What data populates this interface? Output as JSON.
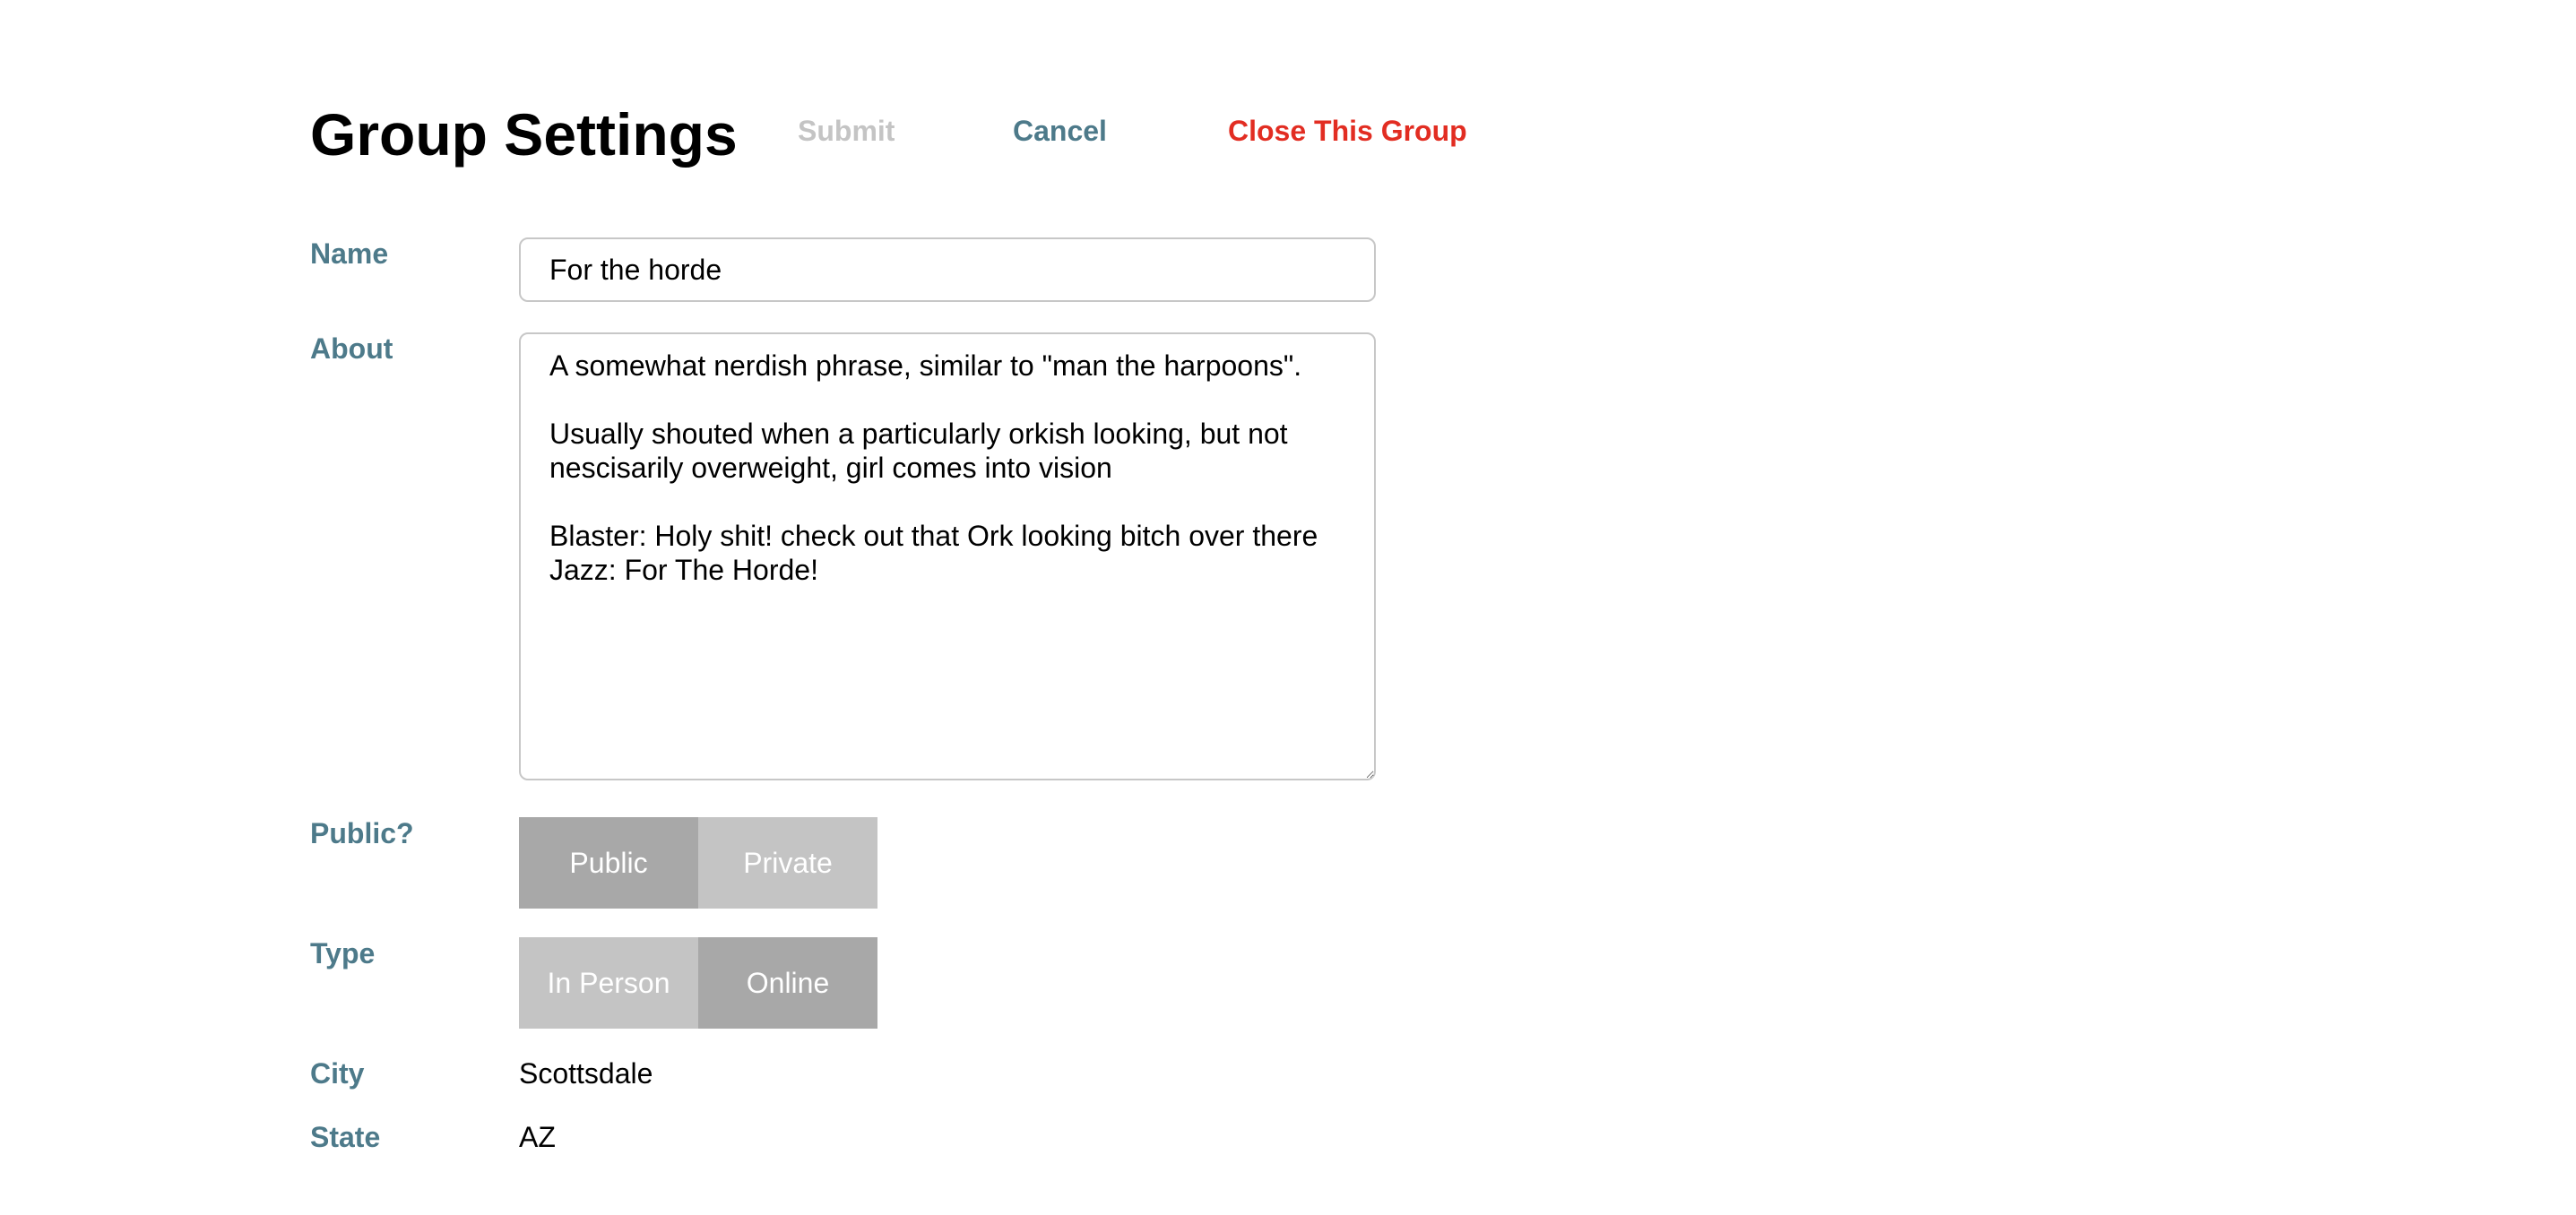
{
  "header": {
    "title": "Group Settings",
    "submit_label": "Submit",
    "cancel_label": "Cancel",
    "close_label": "Close This Group"
  },
  "form": {
    "name": {
      "label": "Name",
      "value": "For the horde"
    },
    "about": {
      "label": "About",
      "value": "A somewhat nerdish phrase, similar to \"man the harpoons\".\n\nUsually shouted when a particularly orkish looking, but not nescisarily overweight, girl comes into vision\n\nBlaster: Holy shit! check out that Ork looking bitch over there\nJazz: For The Horde!"
    },
    "public": {
      "label": "Public?",
      "options": [
        "Public",
        "Private"
      ],
      "selected": "Public"
    },
    "type": {
      "label": "Type",
      "options": [
        "In Person",
        "Online"
      ],
      "selected": "Online"
    },
    "city": {
      "label": "City",
      "value": "Scottsdale"
    },
    "state": {
      "label": "State",
      "value": "AZ"
    }
  },
  "colors": {
    "label": "#4d7a8a",
    "submit_disabled": "#c4c4c4",
    "danger": "#e22d22",
    "toggle_active": "#a8a8a8",
    "toggle_inactive": "#c4c4c4"
  }
}
